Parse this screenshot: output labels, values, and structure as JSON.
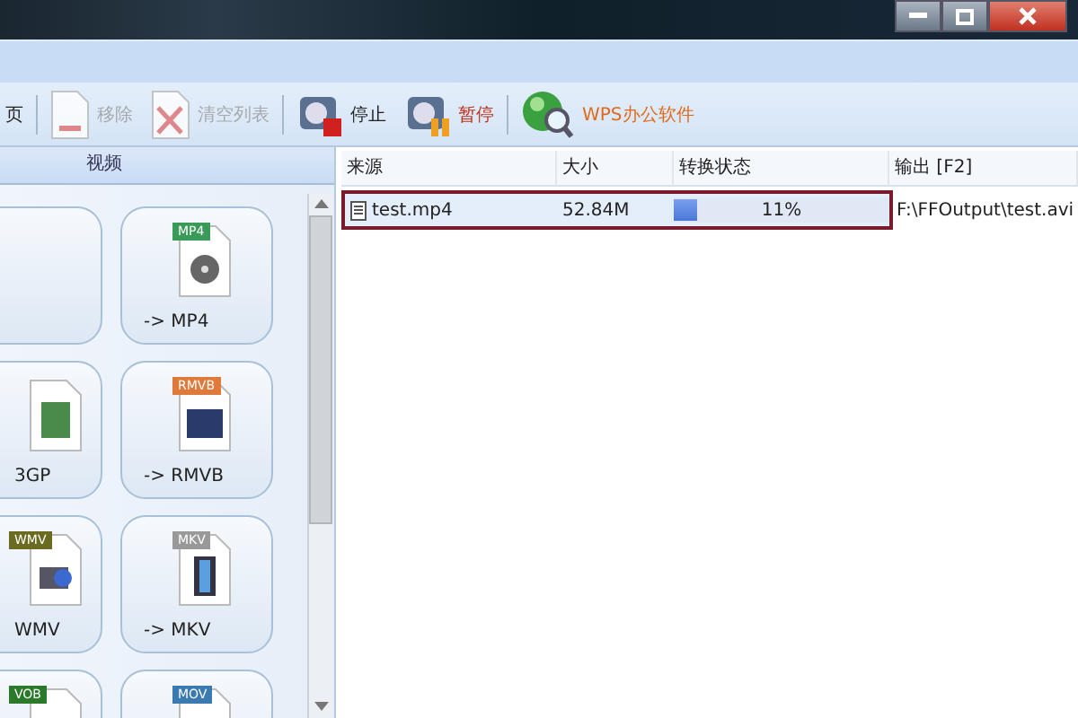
{
  "toolbar": {
    "items": [
      {
        "kind": "text",
        "label": "页",
        "disabled": false
      },
      {
        "kind": "remove",
        "label": "移除",
        "disabled": true
      },
      {
        "kind": "clear",
        "label": "清空列表",
        "disabled": true
      },
      {
        "kind": "stop",
        "label": "停止",
        "disabled": false
      },
      {
        "kind": "pause",
        "label": "暂停",
        "disabled": false
      },
      {
        "kind": "web",
        "label": "WPS办公软件",
        "disabled": false
      }
    ]
  },
  "sidebar": {
    "tab": "视频",
    "items": [
      {
        "kind": "blank"
      },
      {
        "label": "-> MP4",
        "tag": "MP4",
        "kind": "reel"
      },
      {
        "label": "3GP",
        "kind": "phone"
      },
      {
        "label": "-> RMVB",
        "tag": "RMVB",
        "kind": "screen"
      },
      {
        "label": "WMV",
        "tag": "WMV",
        "kind": "camera"
      },
      {
        "label": "-> MKV",
        "tag": "MKV",
        "kind": "film"
      },
      {
        "tag": "VOB",
        "kind": "blank"
      },
      {
        "tag": "MOV",
        "kind": "blank"
      }
    ]
  },
  "table": {
    "columns": [
      "来源",
      "大小",
      "转换状态",
      "输出 [F2]"
    ],
    "rows": [
      {
        "source": "test.mp4",
        "size": "52.84M",
        "level": 0.11,
        "status": "11%",
        "output": "F:\\FFOutput\\test.avi",
        "selected": true
      }
    ]
  }
}
